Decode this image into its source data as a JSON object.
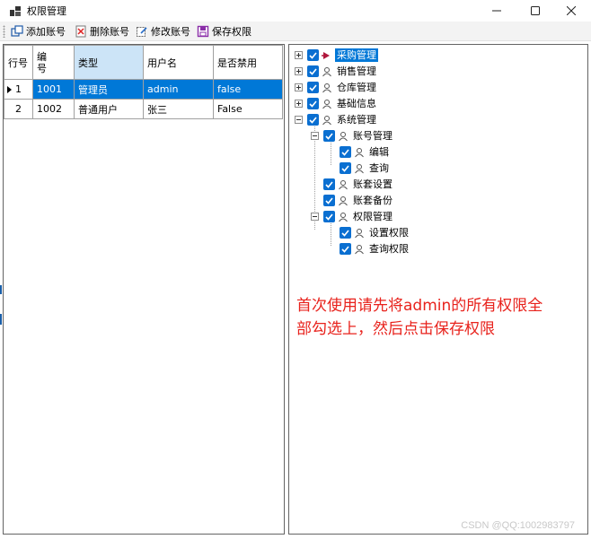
{
  "window": {
    "title": "权限管理"
  },
  "toolbar": {
    "add_label": "添加账号",
    "delete_label": "删除账号",
    "edit_label": "修改账号",
    "save_label": "保存权限"
  },
  "grid": {
    "columns": [
      "行号",
      "编\n号",
      "类型",
      "用户名",
      "是否禁用"
    ],
    "rows": [
      {
        "row_no": "1",
        "id": "1001",
        "type": "管理员",
        "username": "admin",
        "disabled": "false",
        "selected": true
      },
      {
        "row_no": "2",
        "id": "1002",
        "type": "普通用户",
        "username": "张三",
        "disabled": "False",
        "selected": false
      }
    ]
  },
  "tree": {
    "nodes": [
      {
        "label": "采购管理",
        "checked": true,
        "expander": "plus",
        "selected": true
      },
      {
        "label": "销售管理",
        "checked": true,
        "expander": "plus"
      },
      {
        "label": "仓库管理",
        "checked": true,
        "expander": "plus"
      },
      {
        "label": "基础信息",
        "checked": true,
        "expander": "plus"
      },
      {
        "label": "系统管理",
        "checked": true,
        "expander": "minus"
      },
      {
        "label": "账号管理",
        "checked": true,
        "expander": "minus"
      },
      {
        "label": "编辑",
        "checked": true
      },
      {
        "label": "查询",
        "checked": true
      },
      {
        "label": "账套设置",
        "checked": true
      },
      {
        "label": "账套备份",
        "checked": true
      },
      {
        "label": "权限管理",
        "checked": true,
        "expander": "minus"
      },
      {
        "label": "设置权限",
        "checked": true
      },
      {
        "label": "查询权限",
        "checked": true
      }
    ]
  },
  "annotation": {
    "line1": "首次使用请先将admin的所有权限全",
    "line2": "部勾选上，然后点击保存权限"
  },
  "watermark": "CSDN @QQ:1002983797",
  "colors": {
    "selection": "#0078d7",
    "checkbox": "#0a6fd1",
    "annotation": "#e8221c",
    "header_selected": "#cce4f7"
  }
}
